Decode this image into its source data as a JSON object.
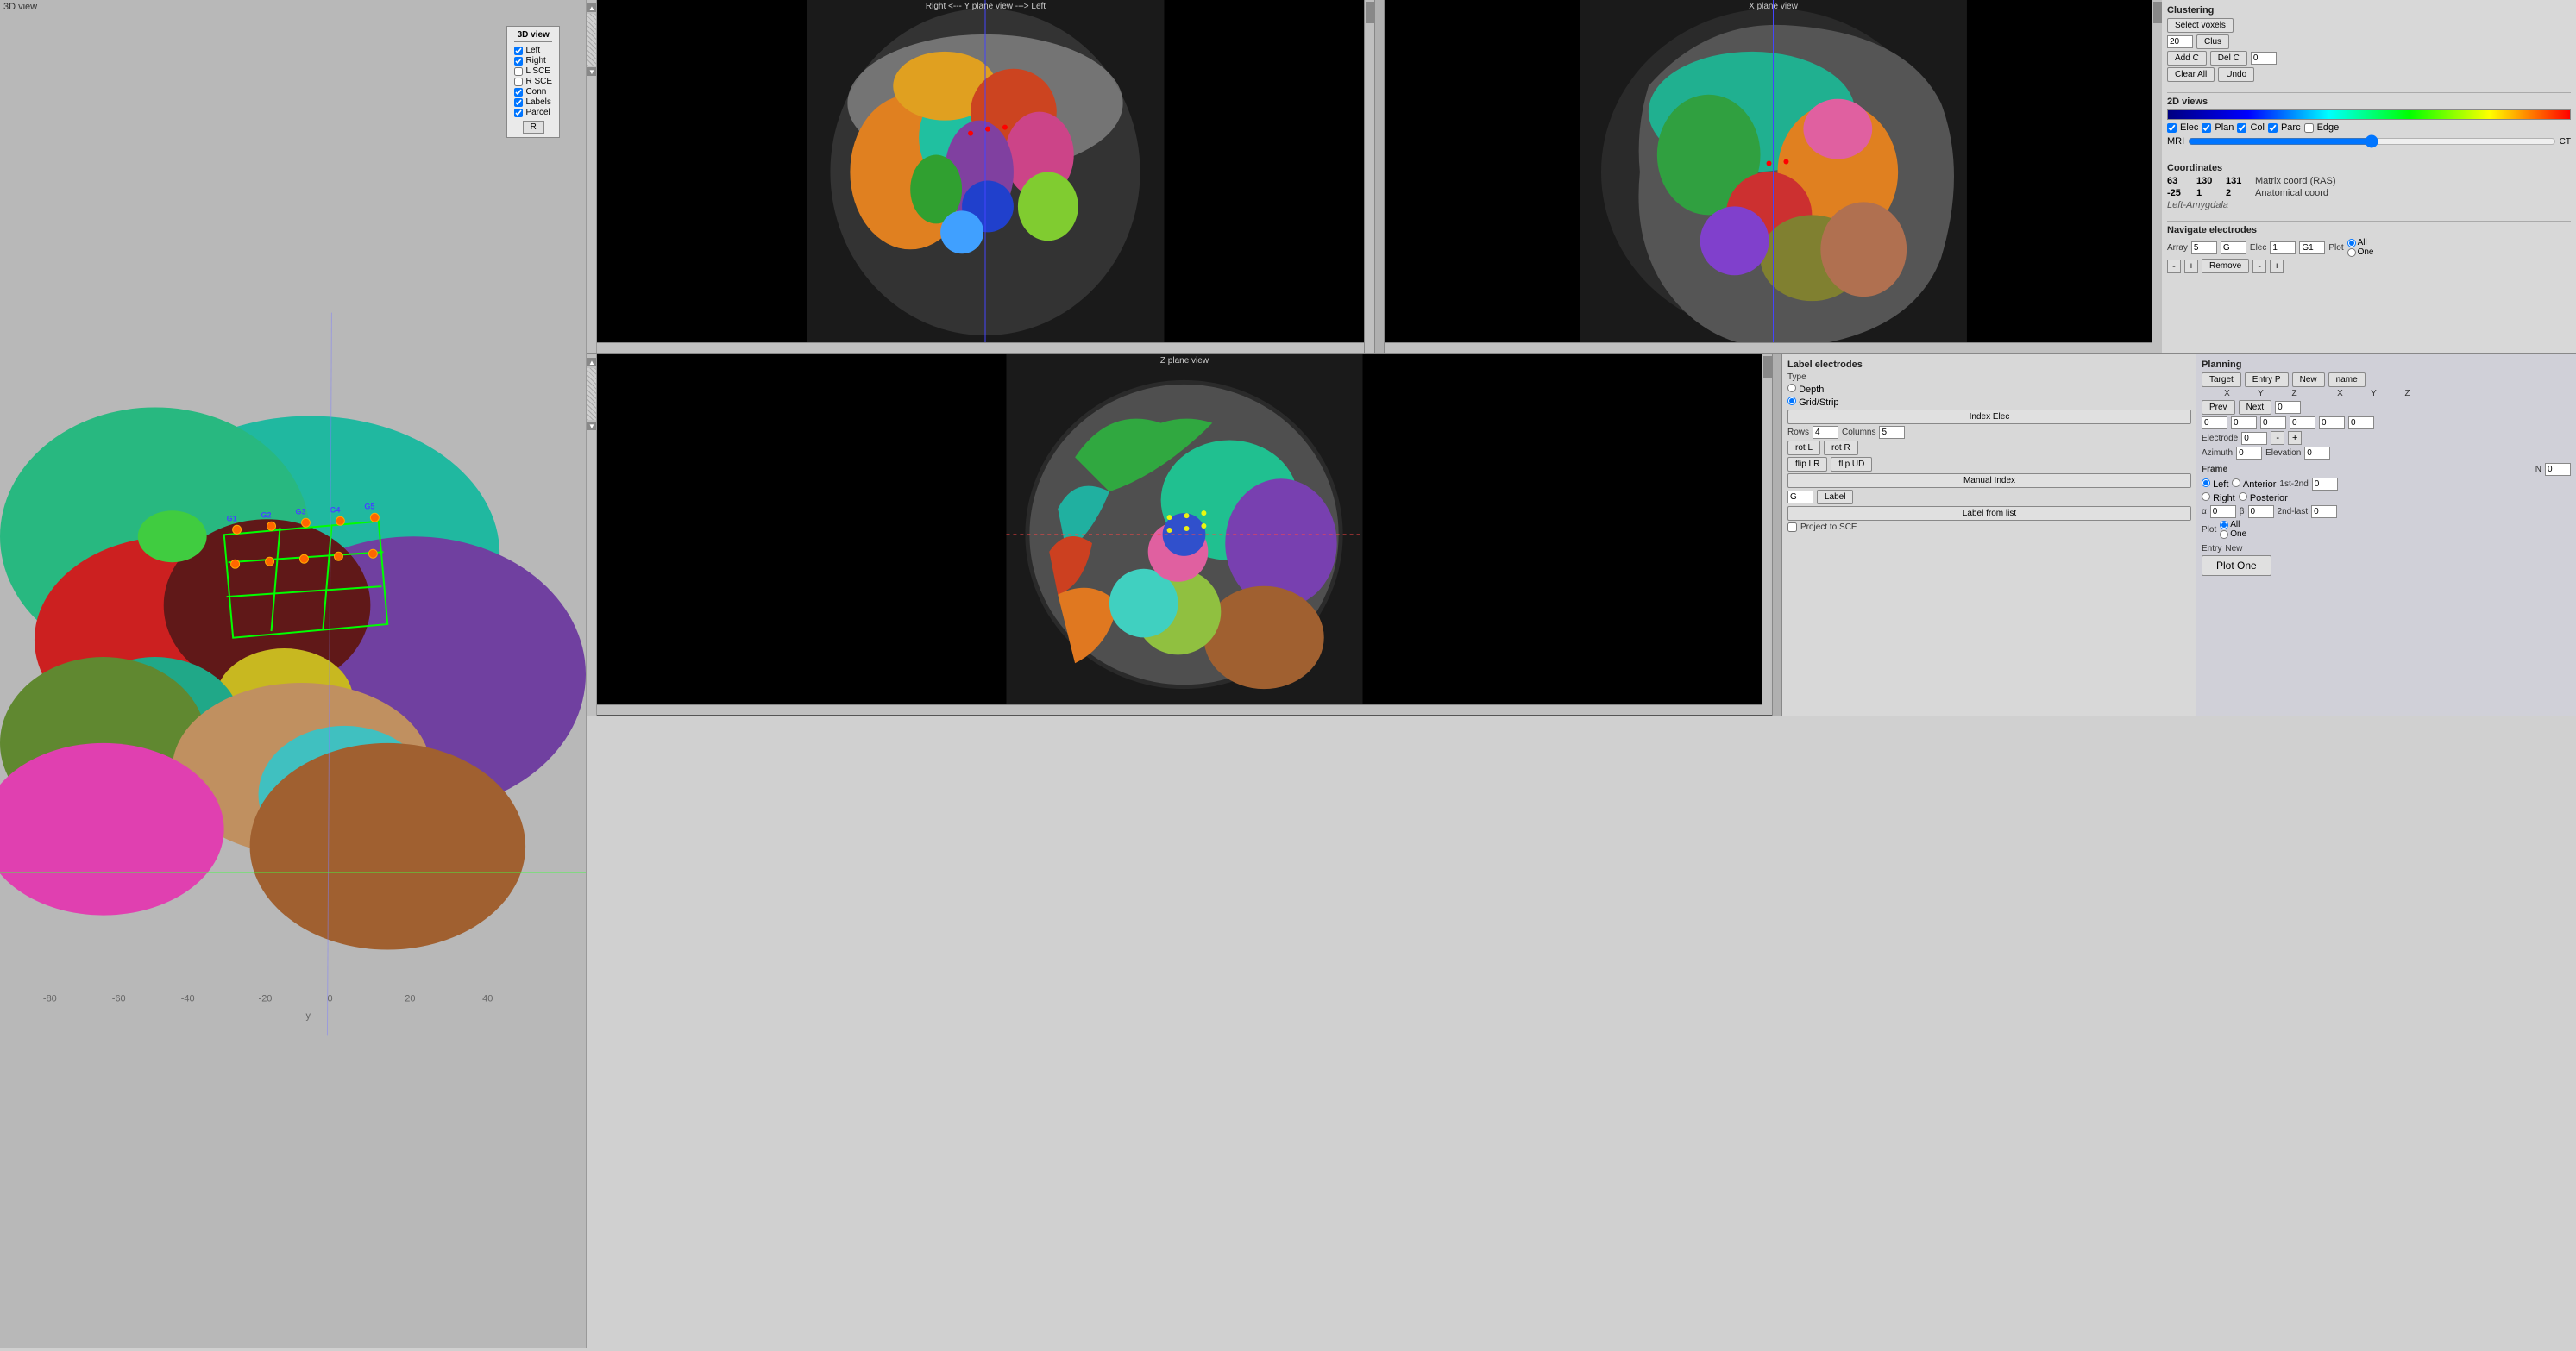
{
  "app": {
    "title_3d": "3D view"
  },
  "view_3d_controls": {
    "title": "3D view",
    "items": [
      {
        "label": "Left",
        "checked": true
      },
      {
        "label": "Right",
        "checked": true
      },
      {
        "label": "L SCE",
        "checked": false
      },
      {
        "label": "R SCE",
        "checked": false
      },
      {
        "label": "Conn",
        "checked": true
      },
      {
        "label": "Labels",
        "checked": true
      },
      {
        "label": "Parcel",
        "checked": true
      }
    ],
    "r_button": "R"
  },
  "y_plane": {
    "title": "Right <---   Y plane view   ---> Left"
  },
  "x_plane": {
    "title": "X plane view"
  },
  "z_plane": {
    "title": "Z plane view"
  },
  "clustering": {
    "title": "Clustering",
    "select_voxels_btn": "Select voxels",
    "clus_value": "20",
    "clus_btn": "Clus",
    "add_c_btn": "Add C",
    "del_c_btn": "Del C",
    "del_c_value": "0",
    "clear_all_btn": "Clear All",
    "undo_btn": "Undo"
  },
  "label_electrodes": {
    "title": "Label electrodes",
    "type_label": "Type",
    "depth_label": "Depth",
    "grid_strip_label": "Grid/Strip",
    "index_elec_btn": "Index Elec",
    "rows_label": "Rows",
    "rows_value": "4",
    "columns_label": "Columns",
    "columns_value": "5",
    "rot_l_btn": "rot L",
    "rot_r_btn": "rot R",
    "flip_lr_btn": "flip LR",
    "flip_ud_btn": "flip UD",
    "manual_index_btn": "Manual Index",
    "g_value": "G",
    "label_btn": "Label",
    "label_from_list_btn": "Label from list",
    "project_sce_label": "Project to SCE"
  },
  "two_d_views": {
    "title": "2D views",
    "elec_check": true,
    "elec_label": "Elec",
    "plan_check": true,
    "plan_label": "Plan",
    "col_check": true,
    "col_label": "Col",
    "parc_check": true,
    "parc_label": "Parc",
    "edge_check": false,
    "edge_label": "Edge",
    "mri_label": "MRI",
    "ct_label": "CT"
  },
  "coordinates": {
    "title": "Coordinates",
    "x": "63",
    "y": "130",
    "z": "131",
    "matrix_label": "Matrix coord (RAS)",
    "x2": "-25",
    "y2": "1",
    "z2": "2",
    "anatomical_label": "Anatomical coord",
    "region_label": "Left-Amygdala"
  },
  "navigate": {
    "title": "Navigate electrodes",
    "array_label": "Array",
    "array_value": "5",
    "g_value": "G",
    "elec_label": "Elec",
    "elec_value": "1",
    "g1_value": "G1",
    "plot_label": "Plot",
    "minus1_btn": "-",
    "plus1_btn": "+",
    "remove_btn": "Remove",
    "minus2_btn": "-",
    "plus2_btn": "+",
    "all_radio": "All",
    "one_radio": "One"
  },
  "planning": {
    "title": "Planning",
    "target_btn": "Target",
    "entry_p_btn": "Entry P",
    "new_btn": "New",
    "name_btn": "name",
    "x_label": "X",
    "y_label": "Y",
    "z_label": "Z",
    "x2_label": "X",
    "y2_label": "Y",
    "z2_label": "Z",
    "prev_btn": "Prev",
    "next_btn": "Next",
    "next_value": "0",
    "electrode_label": "Electrode",
    "electrode_value": "0",
    "minus_elec_btn": "-",
    "plus_elec_btn": "+",
    "coords_target": [
      "0",
      "0",
      "0"
    ],
    "coords_entry": [
      "0",
      "0",
      "0"
    ],
    "azimuth_label": "Azimuth",
    "azimuth_value": "0",
    "elevation_label": "Elevation",
    "elevation_value": "0",
    "frame_title": "Frame",
    "left_radio": "Left",
    "right_radio": "Right",
    "anterior_radio": "Anterior",
    "posterior_radio": "Posterior",
    "first_second_label": "1st-2nd",
    "first_second_value": "0",
    "n_label": "N",
    "n_value": "0",
    "alpha_label": "α",
    "alpha_value": "0",
    "beta_label": "β",
    "beta_value": "0",
    "second_last_label": "2nd-last",
    "second_last_value": "0",
    "plot_label": "Plot",
    "plot_all_radio": "All",
    "plot_one_radio": "One",
    "entry_label": "Entry",
    "new_entry_label": "New",
    "plot_one_btn": "Plot One"
  },
  "axis_labels": {
    "y_neg80": "-80",
    "y_neg60": "-60",
    "y_neg40": "-40",
    "y_neg20": "-20",
    "y_0": "0",
    "y_20": "20",
    "y_40": "40",
    "y_label": "y"
  }
}
